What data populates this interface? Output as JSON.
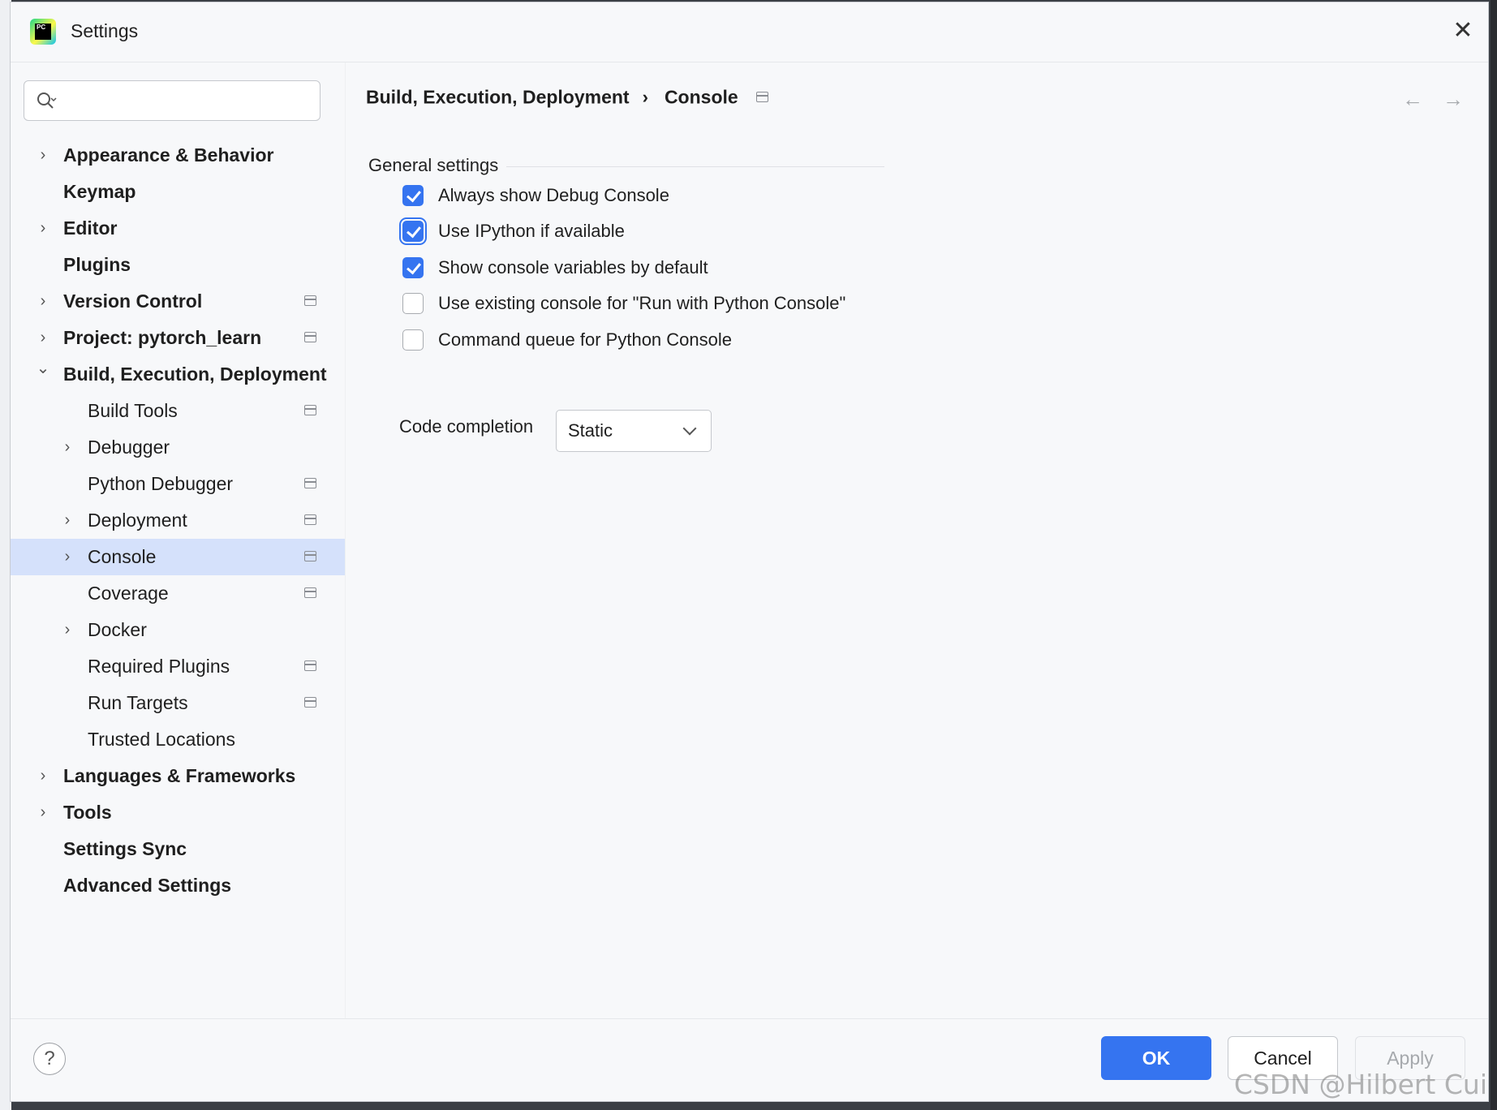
{
  "window": {
    "title": "Settings",
    "app_icon": "pycharm-logo",
    "app_icon_text": "PC",
    "close_icon": "close-icon"
  },
  "search": {
    "value": "",
    "placeholder": "",
    "icon": "search-icon"
  },
  "tree": {
    "items": [
      {
        "label": "Appearance & Behavior",
        "level": "top",
        "expandable": true,
        "expanded": false,
        "project_icon": false
      },
      {
        "label": "Keymap",
        "level": "top",
        "expandable": false,
        "project_icon": false
      },
      {
        "label": "Editor",
        "level": "top",
        "expandable": true,
        "expanded": false,
        "project_icon": false
      },
      {
        "label": "Plugins",
        "level": "top",
        "expandable": false,
        "project_icon": false
      },
      {
        "label": "Version Control",
        "level": "top",
        "expandable": true,
        "expanded": false,
        "project_icon": true
      },
      {
        "label": "Project: pytorch_learn",
        "level": "top",
        "expandable": true,
        "expanded": false,
        "project_icon": true
      },
      {
        "label": "Build, Execution, Deployment",
        "level": "top",
        "expandable": true,
        "expanded": true,
        "project_icon": false
      },
      {
        "label": "Build Tools",
        "level": "sub",
        "expandable": false,
        "project_icon": true
      },
      {
        "label": "Debugger",
        "level": "sub",
        "expandable": true,
        "expanded": false,
        "project_icon": false
      },
      {
        "label": "Python Debugger",
        "level": "sub",
        "expandable": false,
        "project_icon": true
      },
      {
        "label": "Deployment",
        "level": "sub",
        "expandable": true,
        "expanded": false,
        "project_icon": true
      },
      {
        "label": "Console",
        "level": "sub",
        "expandable": true,
        "expanded": false,
        "project_icon": true,
        "selected": true
      },
      {
        "label": "Coverage",
        "level": "sub",
        "expandable": false,
        "project_icon": true
      },
      {
        "label": "Docker",
        "level": "sub",
        "expandable": true,
        "expanded": false,
        "project_icon": false
      },
      {
        "label": "Required Plugins",
        "level": "sub",
        "expandable": false,
        "project_icon": true
      },
      {
        "label": "Run Targets",
        "level": "sub",
        "expandable": false,
        "project_icon": true
      },
      {
        "label": "Trusted Locations",
        "level": "sub",
        "expandable": false,
        "project_icon": false
      },
      {
        "label": "Languages & Frameworks",
        "level": "top",
        "expandable": true,
        "expanded": false,
        "project_icon": false
      },
      {
        "label": "Tools",
        "level": "top",
        "expandable": true,
        "expanded": false,
        "project_icon": false
      },
      {
        "label": "Settings Sync",
        "level": "top",
        "expandable": false,
        "project_icon": false
      },
      {
        "label": "Advanced Settings",
        "level": "top",
        "expandable": false,
        "project_icon": false
      }
    ]
  },
  "breadcrumb": {
    "parent": "Build, Execution, Deployment",
    "separator": "›",
    "current": "Console"
  },
  "nav": {
    "back_icon": "arrow-left-icon",
    "back_glyph": "←",
    "forward_icon": "arrow-right-icon",
    "forward_glyph": "→"
  },
  "general": {
    "title": "General settings",
    "options": [
      {
        "label": "Always show Debug Console",
        "checked": true,
        "focused": false
      },
      {
        "label": "Use IPython if available",
        "checked": true,
        "focused": true
      },
      {
        "label": "Show console variables by default",
        "checked": true,
        "focused": false
      },
      {
        "label": "Use existing console for \"Run with Python Console\"",
        "checked": false,
        "focused": false
      },
      {
        "label": "Command queue for Python Console",
        "checked": false,
        "focused": false
      }
    ],
    "code_completion": {
      "label": "Code completion",
      "value": "Static"
    }
  },
  "buttons": {
    "help": "?",
    "ok": "OK",
    "cancel": "Cancel",
    "apply": "Apply",
    "apply_enabled": false
  },
  "watermark": "CSDN @Hilbert Cui",
  "colors": {
    "accent": "#3574f0",
    "selection": "#d5e1fb",
    "background": "#f7f8fa"
  }
}
